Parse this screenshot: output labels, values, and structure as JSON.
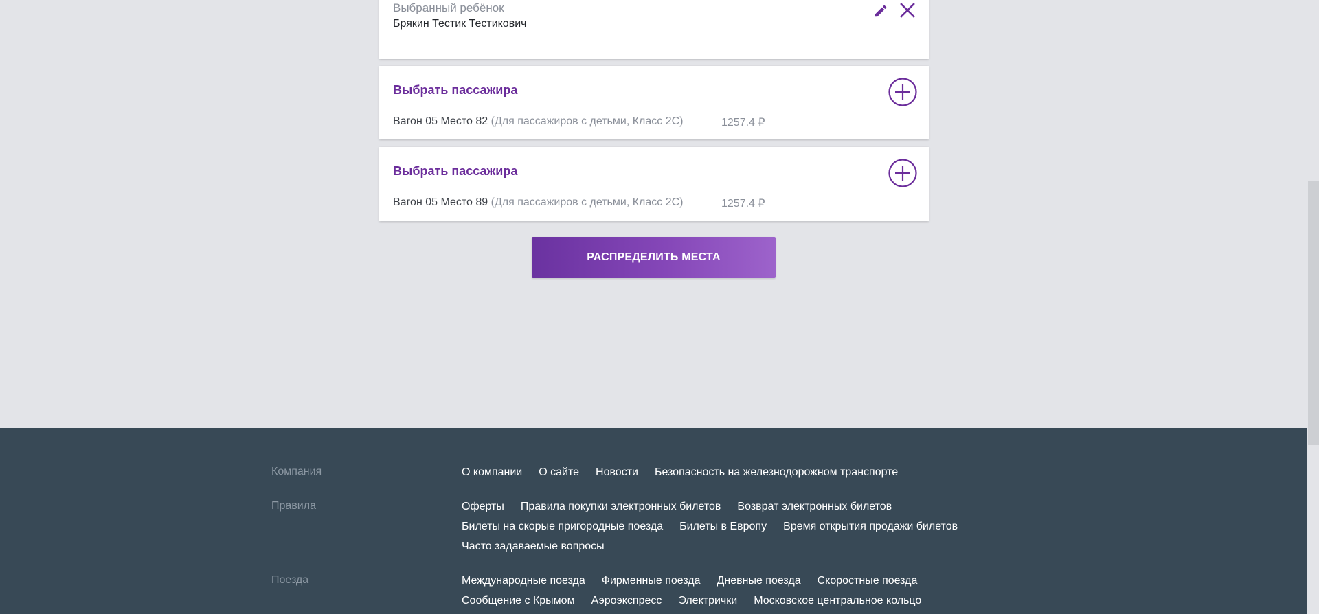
{
  "child": {
    "label": "Выбранный ребёнок",
    "name": "Брякин Тестик Тестикович",
    "edit_icon": "pencil-icon",
    "close_icon": "close-icon"
  },
  "passengers": [
    {
      "title": "Выбрать пассажира",
      "seat": "Вагон 05 Место 82",
      "seat_details": "(Для пассажиров с детьми, Класс 2С)",
      "price": "1257.4 ₽",
      "add_icon": "plus-circle-icon"
    },
    {
      "title": "Выбрать пассажира",
      "seat": "Вагон 05 Место 89",
      "seat_details": "(Для пассажиров с детьми, Класс 2С)",
      "price": "1257.4 ₽",
      "add_icon": "plus-circle-icon"
    }
  ],
  "actions": {
    "distribute_label": "РАСПРЕДЕЛИТЬ МЕСТА"
  },
  "footer": {
    "company": {
      "heading": "Компания",
      "links": [
        "О компании",
        "О сайте",
        "Новости",
        "Безопасность на железнодорожном транспорте"
      ]
    },
    "rules": {
      "heading": "Правила",
      "links": [
        "Оферты",
        "Правила покупки электронных билетов",
        "Возврат электронных билетов",
        "Билеты на скорые пригородные поезда",
        "Билеты в Европу",
        "Время открытия продажи билетов",
        "Часто задаваемые вопросы"
      ]
    },
    "trains": {
      "heading": "Поезда",
      "links": [
        "Международные поезда",
        "Фирменные поезда",
        "Дневные поезда",
        "Скоростные поезда",
        "Сообщение с Крымом",
        "Аэроэкспресс",
        "Электрички",
        "Московское центральное кольцо"
      ]
    }
  },
  "colors": {
    "accent": "#6b2d9b",
    "background": "#e3e4e8",
    "footer": "#384956"
  }
}
